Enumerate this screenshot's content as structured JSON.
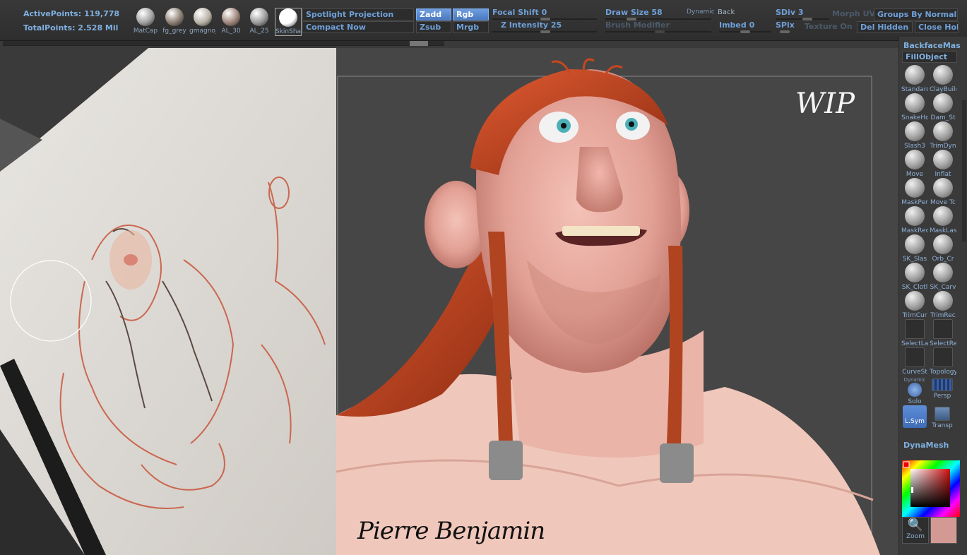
{
  "stats": {
    "active_points": "ActivePoints: 119,778",
    "total_points": "TotalPoints: 2.528 Mil"
  },
  "matcaps": [
    {
      "label": "MatCap",
      "color": "#a0a0a0"
    },
    {
      "label": "fg_grey",
      "color": "#8a7c70"
    },
    {
      "label": "gmagno_",
      "color": "#b8b2a6"
    },
    {
      "label": "AL_30",
      "color": "#9e8478"
    },
    {
      "label": "AL_25",
      "color": "#9a9a9a"
    },
    {
      "label": "SkinShad",
      "color": "#ffffff"
    }
  ],
  "toolbar": {
    "spotlight": "Spotlight Projection",
    "compact": "Compact Now",
    "zadd": "Zadd",
    "rgb": "Rgb",
    "zsub": "Zsub",
    "mrgb": "Mrgb",
    "focal_shift_label": "Focal Shift",
    "focal_shift_value": "0",
    "z_intensity_label": "Z Intensity",
    "z_intensity_value": "25",
    "draw_size_label": "Draw Size",
    "draw_size_value": "58",
    "dynamic": "Dynamic",
    "back": "Back",
    "brush_modifier": "Brush Modifier",
    "imbed_label": "Imbed",
    "imbed_value": "0",
    "sdiv_label": "SDiv",
    "sdiv_value": "3",
    "spix": "SPix",
    "morph_uv": "Morph UV",
    "texture_on": "Texture On",
    "groups_by_normals": "Groups By Normals",
    "del_hidden": "Del Hidden",
    "close_holes": "Close Holes"
  },
  "tray": {
    "backface": "BackfaceMas",
    "fillobject": "FillObject",
    "brushes": [
      {
        "label": "Standard"
      },
      {
        "label": "ClayBuild"
      },
      {
        "label": "SnakeHo"
      },
      {
        "label": "Dam_St"
      },
      {
        "label": "Slash3"
      },
      {
        "label": "TrimDyn"
      },
      {
        "label": "Move"
      },
      {
        "label": "Inflat"
      },
      {
        "label": "MaskPer"
      },
      {
        "label": "Move Tc"
      },
      {
        "label": "MaskRec"
      },
      {
        "label": "MaskLas"
      },
      {
        "label": "SK_Slas"
      },
      {
        "label": "Orb_Cr"
      },
      {
        "label": "SK_Clotl"
      },
      {
        "label": "SK_Carv"
      },
      {
        "label": "TrimCur"
      },
      {
        "label": "TrimRec"
      },
      {
        "label": "SelectLa"
      },
      {
        "label": "SelectRe"
      },
      {
        "label": "CurveSt"
      },
      {
        "label": "Topology"
      }
    ],
    "dynamic_solo_top": "Dynamic",
    "solo": "Solo",
    "persp": "Persp",
    "lsym": "L.Sym",
    "transp": "Transp",
    "dynamesh": "DynaMesh",
    "zoom": "Zoom",
    "swatch_color": "#d39a94"
  },
  "canvas": {
    "wip": "WIP",
    "signature": "Pierre Benjamin"
  }
}
